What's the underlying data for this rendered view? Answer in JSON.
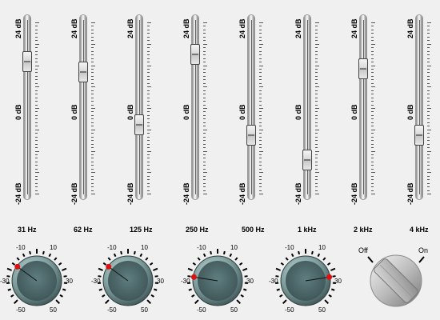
{
  "bands": [
    {
      "freq": "31 Hz",
      "gain_db": 13
    },
    {
      "freq": "62 Hz",
      "gain_db": 10
    },
    {
      "freq": "125 Hz",
      "gain_db": -5
    },
    {
      "freq": "250 Hz",
      "gain_db": 15
    },
    {
      "freq": "500 Hz",
      "gain_db": -8
    },
    {
      "freq": "1 kHz",
      "gain_db": -15
    },
    {
      "freq": "2 kHz",
      "gain_db": 11
    },
    {
      "freq": "4 kHz",
      "gain_db": -8
    }
  ],
  "scale": {
    "top": "24 dB",
    "middle": "0 dB",
    "bottom": "-24 dB"
  },
  "knobs": [
    {
      "value": -20,
      "labels": {
        "l_top": "-10",
        "r_top": "10",
        "l_mid": "-30",
        "r_mid": "30",
        "l_bot": "-50",
        "r_bot": "50"
      }
    },
    {
      "value": -20,
      "labels": {
        "l_top": "-10",
        "r_top": "10",
        "l_mid": "-30",
        "r_mid": "30",
        "l_bot": "-50",
        "r_bot": "50"
      }
    },
    {
      "value": -30,
      "labels": {
        "l_top": "-10",
        "r_top": "10",
        "l_mid": "-30",
        "r_mid": "30",
        "l_bot": "-50",
        "r_bot": "50"
      }
    },
    {
      "value": 30,
      "labels": {
        "l_top": "-10",
        "r_top": "10",
        "l_mid": "-30",
        "r_mid": "30",
        "l_bot": "-50",
        "r_bot": "50"
      }
    }
  ],
  "switch": {
    "off_label": "Off",
    "on_label": "On",
    "state": "on"
  },
  "colors": {
    "knob_face": "#4f6c6e",
    "knob_marker": "#e01010",
    "tick": "#000000"
  }
}
